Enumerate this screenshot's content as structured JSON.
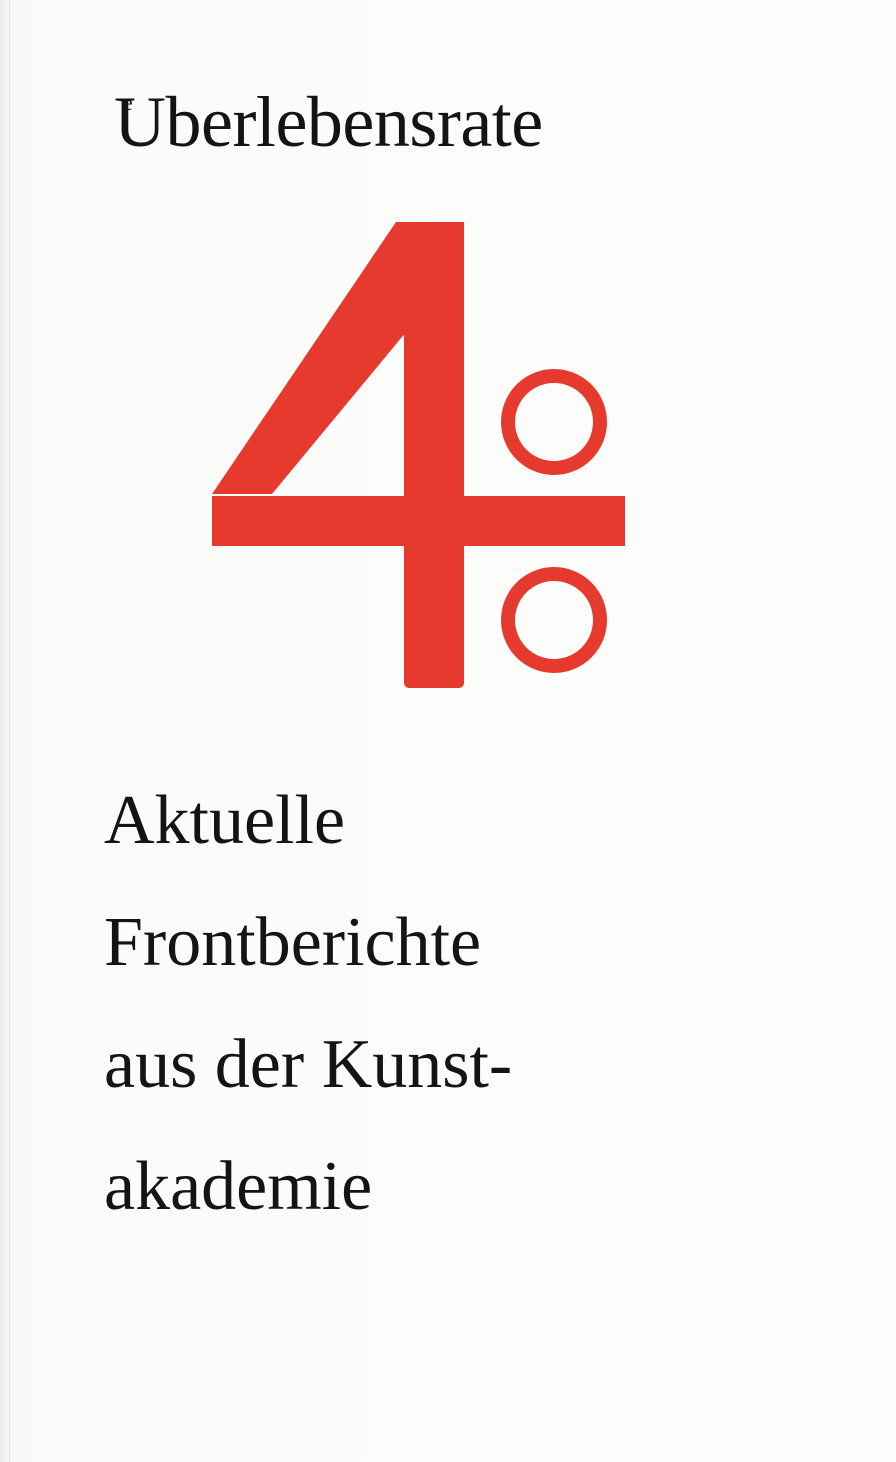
{
  "cover": {
    "title_initial": "U",
    "title_initial_inset": "e",
    "title_rest": "berlebensrate",
    "emblem": {
      "number": "4",
      "symbol": "percent",
      "color": "#e63a2e"
    },
    "subtitle_lines": [
      "Aktuelle",
      "Frontberichte",
      "aus der Kunst-",
      "akademie"
    ],
    "text_color": "#141414"
  }
}
